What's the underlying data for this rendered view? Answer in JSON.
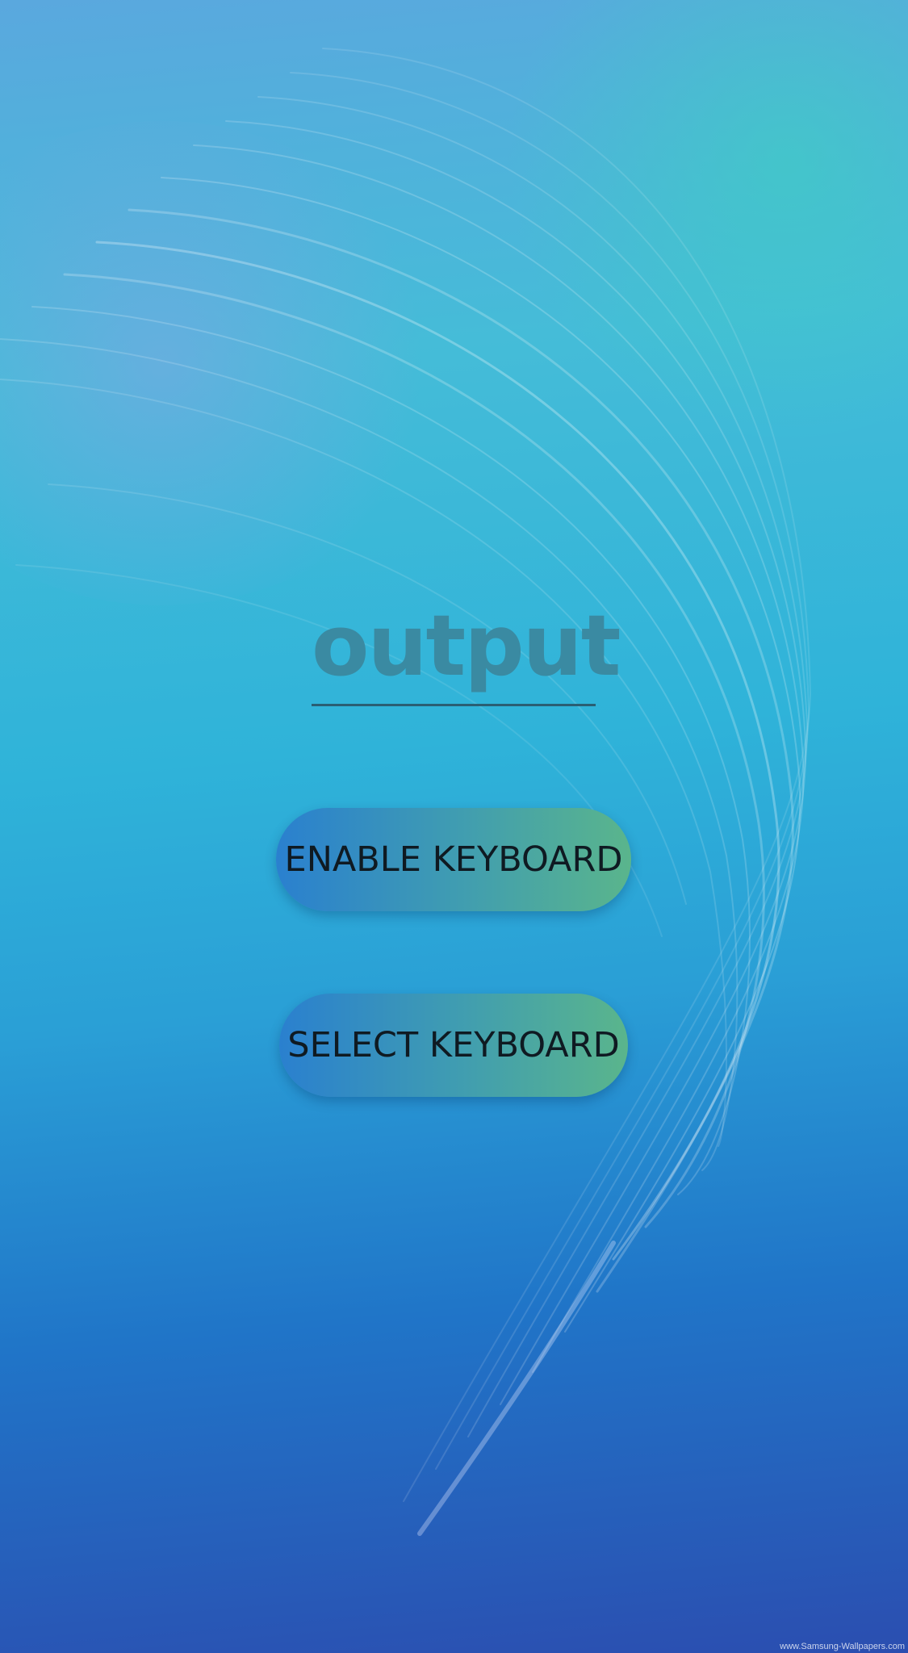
{
  "output": {
    "text": "output"
  },
  "buttons": {
    "enable_label": "ENABLE KEYBOARD",
    "select_label": "SELECT KEYBOARD"
  },
  "watermark": {
    "text": "www.Samsung-Wallpapers.com"
  },
  "colors": {
    "button_gradient_start": "#2a80cf",
    "button_gradient_end": "#5ab58c",
    "output_text": "#3a8aa2",
    "button_text": "#0f1a22"
  }
}
